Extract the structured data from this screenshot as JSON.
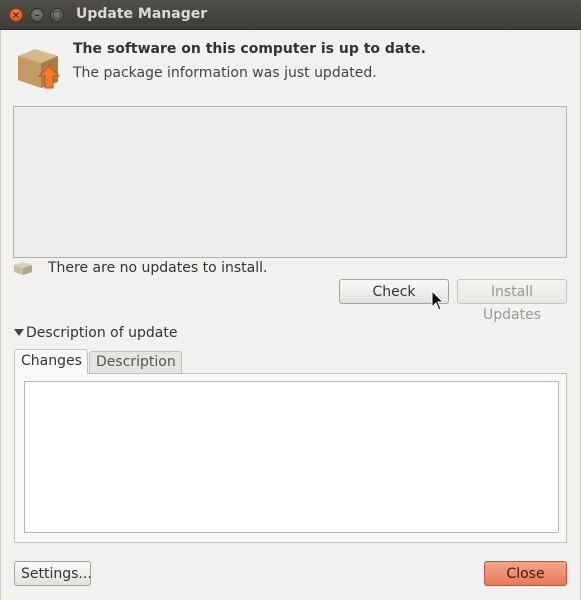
{
  "window": {
    "title": "Update Manager",
    "controls": {
      "close": "×",
      "minimize": "–",
      "maximize": "□"
    }
  },
  "header": {
    "title": "The software on this computer is up to date.",
    "subtitle": "The package information was just updated.",
    "icon": "package-upgrade-icon"
  },
  "status": {
    "text": "There are no updates to install.",
    "icon": "package-icon"
  },
  "buttons": {
    "check": "Check",
    "install": "Install Updates",
    "settings": "Settings...",
    "close": "Close"
  },
  "description": {
    "expander_label": "Description of update",
    "tabs": [
      "Changes",
      "Description"
    ],
    "active_tab": "Changes"
  },
  "colors": {
    "accent_close": "#e7795a",
    "titlebar": "#3d3c38"
  }
}
